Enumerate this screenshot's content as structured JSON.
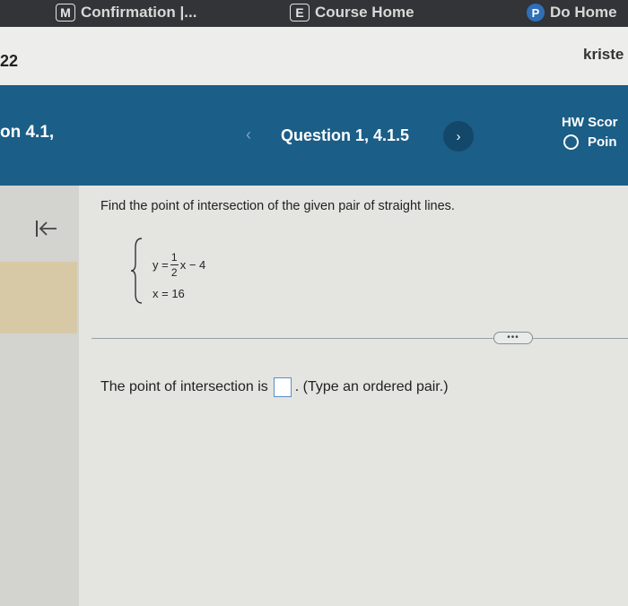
{
  "bookmarks": [
    {
      "badge": "M",
      "label": "Confirmation |...",
      "icon": "m-badge-icon"
    },
    {
      "badge": "E",
      "label": "Course Home",
      "icon": "e-badge-icon"
    },
    {
      "badge": "P",
      "label": "Do Home",
      "icon": "p-circle-icon"
    }
  ],
  "account": {
    "number": "22",
    "user": "kriste"
  },
  "header": {
    "section": "on 4.1,",
    "question": "Question 1, 4.1.5",
    "hw_score": "HW Scor",
    "points": "Poin"
  },
  "colors": {
    "header": "#1b5e87",
    "answer_box_border": "#5b8fc4"
  },
  "problem": {
    "prompt": "Find the point of intersection of the given pair of straight lines.",
    "eq1_lhs": "y =",
    "eq1_num": "1",
    "eq1_den": "2",
    "eq1_rhs": "x − 4",
    "eq2": "x = 16"
  },
  "more_label": "•••",
  "answer": {
    "prefix": "The point of intersection is",
    "suffix": ". (Type an ordered pair.)"
  }
}
